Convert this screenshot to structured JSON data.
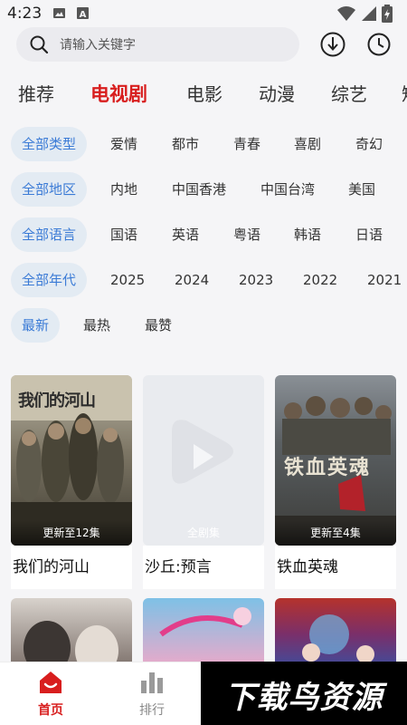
{
  "status": {
    "time": "4:23"
  },
  "search": {
    "placeholder": "请输入关键字"
  },
  "tabs": [
    {
      "label": "推荐"
    },
    {
      "label": "电视剧"
    },
    {
      "label": "电影"
    },
    {
      "label": "动漫"
    },
    {
      "label": "综艺"
    },
    {
      "label": "短"
    }
  ],
  "filters": {
    "type": [
      "全部类型",
      "爱情",
      "都市",
      "青春",
      "喜剧",
      "奇幻"
    ],
    "region": [
      "全部地区",
      "内地",
      "中国香港",
      "中国台湾",
      "美国"
    ],
    "language": [
      "全部语言",
      "国语",
      "英语",
      "粤语",
      "韩语",
      "日语"
    ],
    "year": [
      "全部年代",
      "2025",
      "2024",
      "2023",
      "2022",
      "2021"
    ],
    "sort": [
      "最新",
      "最热",
      "最赞"
    ]
  },
  "cards": [
    {
      "title": "我们的河山",
      "episode": "更新至12集",
      "poster_text": "我们的河山"
    },
    {
      "title": "沙丘:预言",
      "episode": "全剧集"
    },
    {
      "title": "铁血英魂",
      "episode": "更新至4集",
      "poster_text": "铁血英魂"
    }
  ],
  "bottom_nav": [
    {
      "label": "首页"
    },
    {
      "label": "排行"
    }
  ],
  "watermark": "下载鸟资源",
  "colors": {
    "accent_red": "#d81e1e",
    "chip_blue": "#3b7bd6",
    "chip_bg": "#e3ebf3"
  }
}
